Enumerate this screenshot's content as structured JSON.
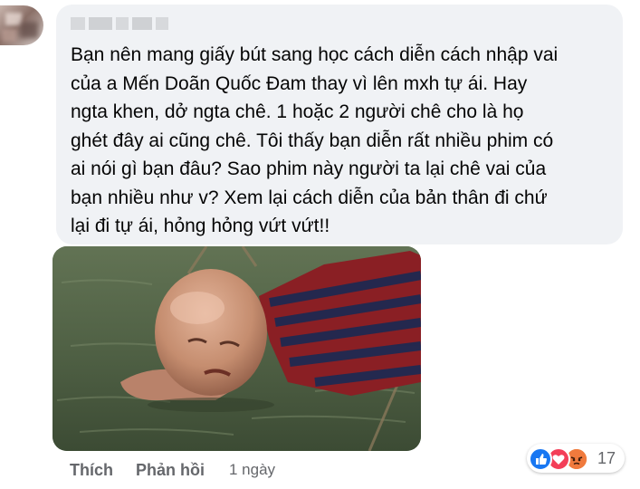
{
  "comment": {
    "author_name": "",
    "text": "Bạn nên mang giấy bút sang học cách diễn cách nhập vai\ncủa a Mến Doãn Quốc Đam thay vì lên mxh tự ái. Hay\nngta khen, dở ngta chê. 1 hoặc 2 người chê cho là họ\nghét đây ai cũng chê. Tôi thấy bạn diễn rất nhiều phim có\nai nói gì bạn đâu? Sao phim này người ta lại chê vai của\nbạn nhiều như v? Xem lại cách diễn của bản thân đi chứ\nlại đi tự ái, hỏng hỏng vứt vứt!!"
  },
  "actions": {
    "like_label": "Thích",
    "reply_label": "Phản hồi",
    "timestamp": "1 ngày"
  },
  "reactions": {
    "count": "17",
    "icons": [
      "like-icon",
      "love-icon",
      "angry-icon"
    ],
    "colors": {
      "like": "#1877f2",
      "love": "#f33e58",
      "angry": "#e9710f"
    }
  }
}
